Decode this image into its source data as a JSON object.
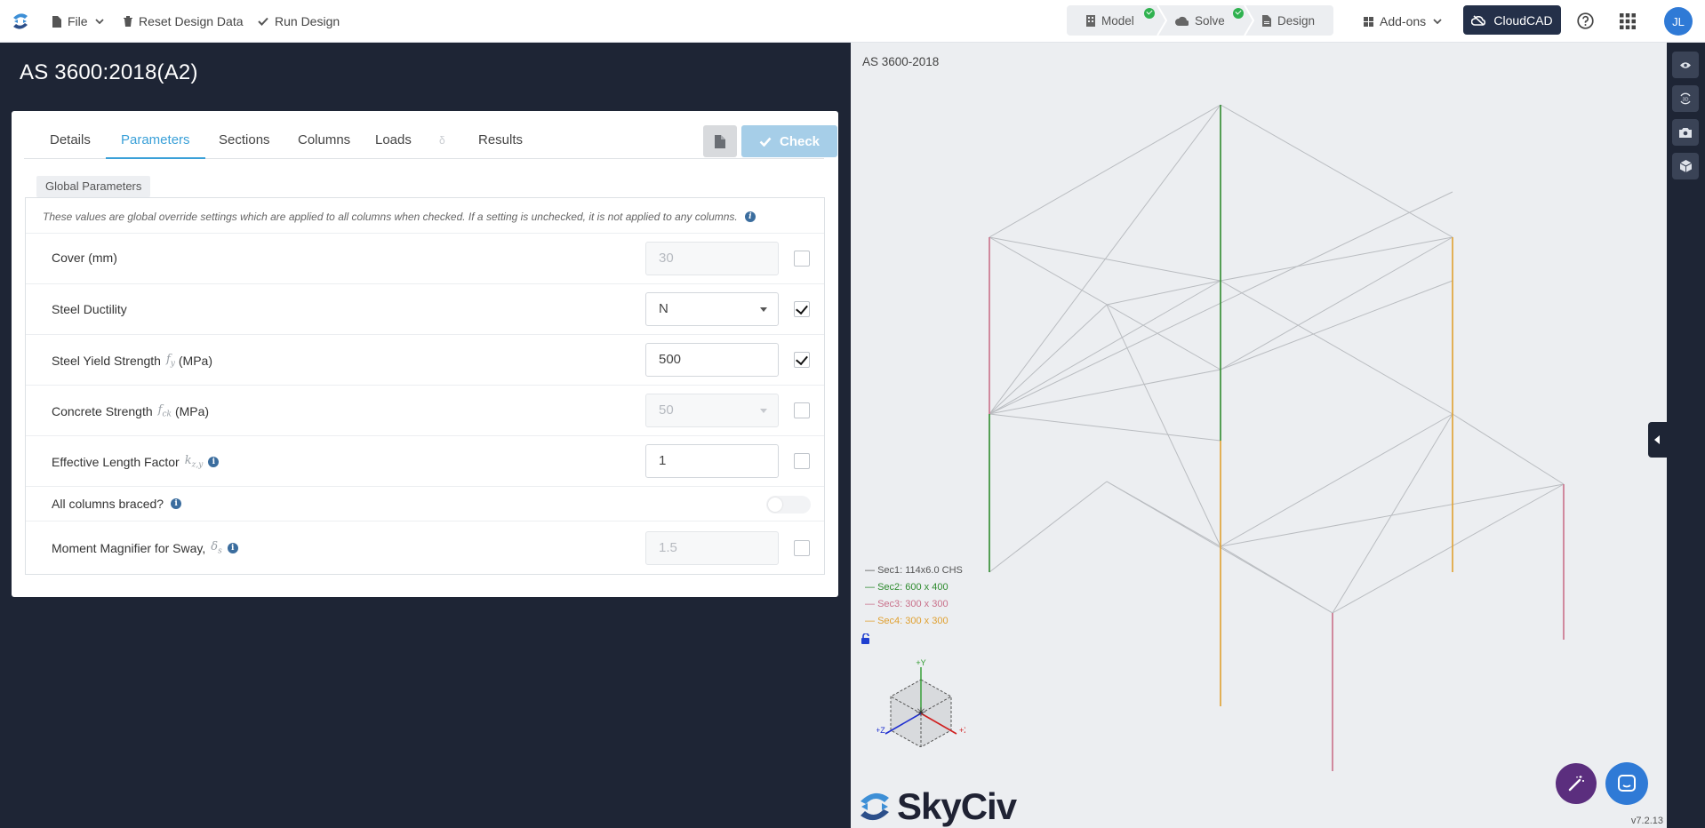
{
  "topbar": {
    "file_label": "File",
    "reset_label": "Reset Design Data",
    "run_label": "Run Design",
    "steps": [
      "Model",
      "Solve",
      "Design"
    ],
    "addons_label": "Add-ons",
    "cloudcad_label": "CloudCAD",
    "avatar_initials": "JL"
  },
  "page": {
    "title": "AS 3600:2018(A2)"
  },
  "tabs": {
    "items": [
      "Details",
      "Parameters",
      "Sections",
      "Columns",
      "Loads",
      "δ",
      "Results"
    ],
    "active": "Parameters",
    "check_label": "Check"
  },
  "params": {
    "group_label": "Global Parameters",
    "note": "These values are global override settings which are applied to all columns when checked. If a setting is unchecked, it is not applied to any columns.",
    "rows": [
      {
        "label": "Cover (mm)",
        "value": "30",
        "checked": false,
        "enabled": false
      },
      {
        "label": "Steel Ductility",
        "value": "N",
        "checked": true,
        "enabled": true
      },
      {
        "label": "Steel Yield Strength",
        "symbol": "f",
        "sub": "y",
        "unit": "(MPa)",
        "value": "500",
        "checked": true,
        "enabled": true
      },
      {
        "label": "Concrete Strength",
        "symbol": "f",
        "sub": "ck",
        "unit": "(MPa)",
        "value": "50",
        "checked": false,
        "enabled": false
      },
      {
        "label": "Effective Length Factor",
        "symbol": "k",
        "sub": "z,y",
        "value": "1",
        "checked": false,
        "enabled": true
      },
      {
        "label": "All columns braced?",
        "toggle_on": false
      },
      {
        "label": "Moment Magnifier for Sway,",
        "symbol": "δ",
        "sub": "s",
        "value": "1.5",
        "checked": false,
        "enabled": false
      }
    ]
  },
  "viewport": {
    "label": "AS 3600-2018",
    "legend": [
      {
        "text": "Sec1: 114x6.0 CHS",
        "color": "#555555"
      },
      {
        "text": "Sec2: 600 x 400",
        "color": "#2e8b2e"
      },
      {
        "text": "Sec3: 300 x 300",
        "color": "#c9708a"
      },
      {
        "text": "Sec4: 300 x 300",
        "color": "#e0a030"
      }
    ],
    "axes": {
      "y": "+Y",
      "x": "+X",
      "z": "+Z"
    },
    "brand": "SkyCiv",
    "version": "v7.2.13"
  },
  "colors": {
    "accent": "#3aa0d8",
    "dark": "#1e2535",
    "check_disabled": "#a6cee8"
  }
}
